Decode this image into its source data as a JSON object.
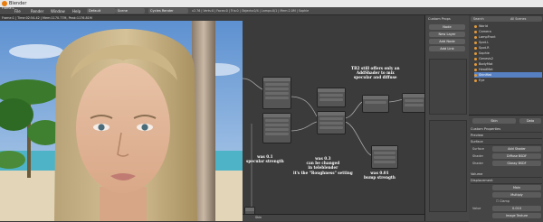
{
  "app": {
    "title": "Blender"
  },
  "menu": {
    "items": [
      "File",
      "Render",
      "Window",
      "Help"
    ],
    "screen_layout": "Default",
    "scene": "Scene",
    "engine": "Cycles Render",
    "stats": "v2.76 | Verts:0 | Faces:0 | Tris:0 | Objects:0/4 | Lamps:0/1 | Mem:2.0M | Sophie"
  },
  "render_view": {
    "header": "Frame:1 | Time:02:54.42 | Mem:1170.77M, Peak:1176.81M",
    "frame_label": "Frame:1"
  },
  "node_editor": {
    "annotations": {
      "top_right": [
        "TB2 still offers only an",
        "AddShader to mix",
        "specular and diffuse"
      ],
      "left": [
        "was 0.1",
        "specular strength"
      ],
      "middle": [
        "was 0.3",
        "can be changed",
        "in teleblender",
        "it's the \"Roughness\" setting"
      ],
      "right": [
        "was 0.01",
        "bump strength"
      ]
    },
    "footer_label": "Skin"
  },
  "tool_strip": {
    "header": "Custom Props",
    "buttons": [
      "Node",
      "New Layer",
      "Add Node",
      "Add Link"
    ]
  },
  "outliner": {
    "view_label": "Search",
    "filter": "All Scenes",
    "items": [
      {
        "label": "World",
        "selected": false
      },
      {
        "label": "Camera",
        "selected": false
      },
      {
        "label": "LampFront",
        "selected": false
      },
      {
        "label": "Spot.L",
        "selected": false
      },
      {
        "label": "Spot.R",
        "selected": false
      },
      {
        "label": "Sophie",
        "selected": false
      },
      {
        "label": "Genesis2",
        "selected": false
      },
      {
        "label": "BodyMat",
        "selected": false
      },
      {
        "label": "HeadMat",
        "selected": false
      },
      {
        "label": "SkinMat",
        "selected": true
      },
      {
        "label": "Eye",
        "selected": false
      }
    ]
  },
  "properties": {
    "material_name": "Skin",
    "data_label": "Data",
    "sections": [
      "Custom Properties",
      "Preview",
      "Surface"
    ],
    "surface_label": "Surface",
    "surface_value": "Add Shader",
    "shader_label": "Shader",
    "shader1": "Diffuse BSDF",
    "shader2": "Glossy BSDF",
    "volume_label": "Volume",
    "displacement_label": "Displacement",
    "displacement_value": "Main",
    "blend_label": "Multiply",
    "clamp_label": "Clamp",
    "value_label": "Value",
    "value_number": "0.010",
    "image_label": "Image Texture"
  },
  "colors": {
    "accent": "#e87d0d",
    "selection": "#5680c2",
    "node_editor_bg": "#3b3b3b"
  }
}
